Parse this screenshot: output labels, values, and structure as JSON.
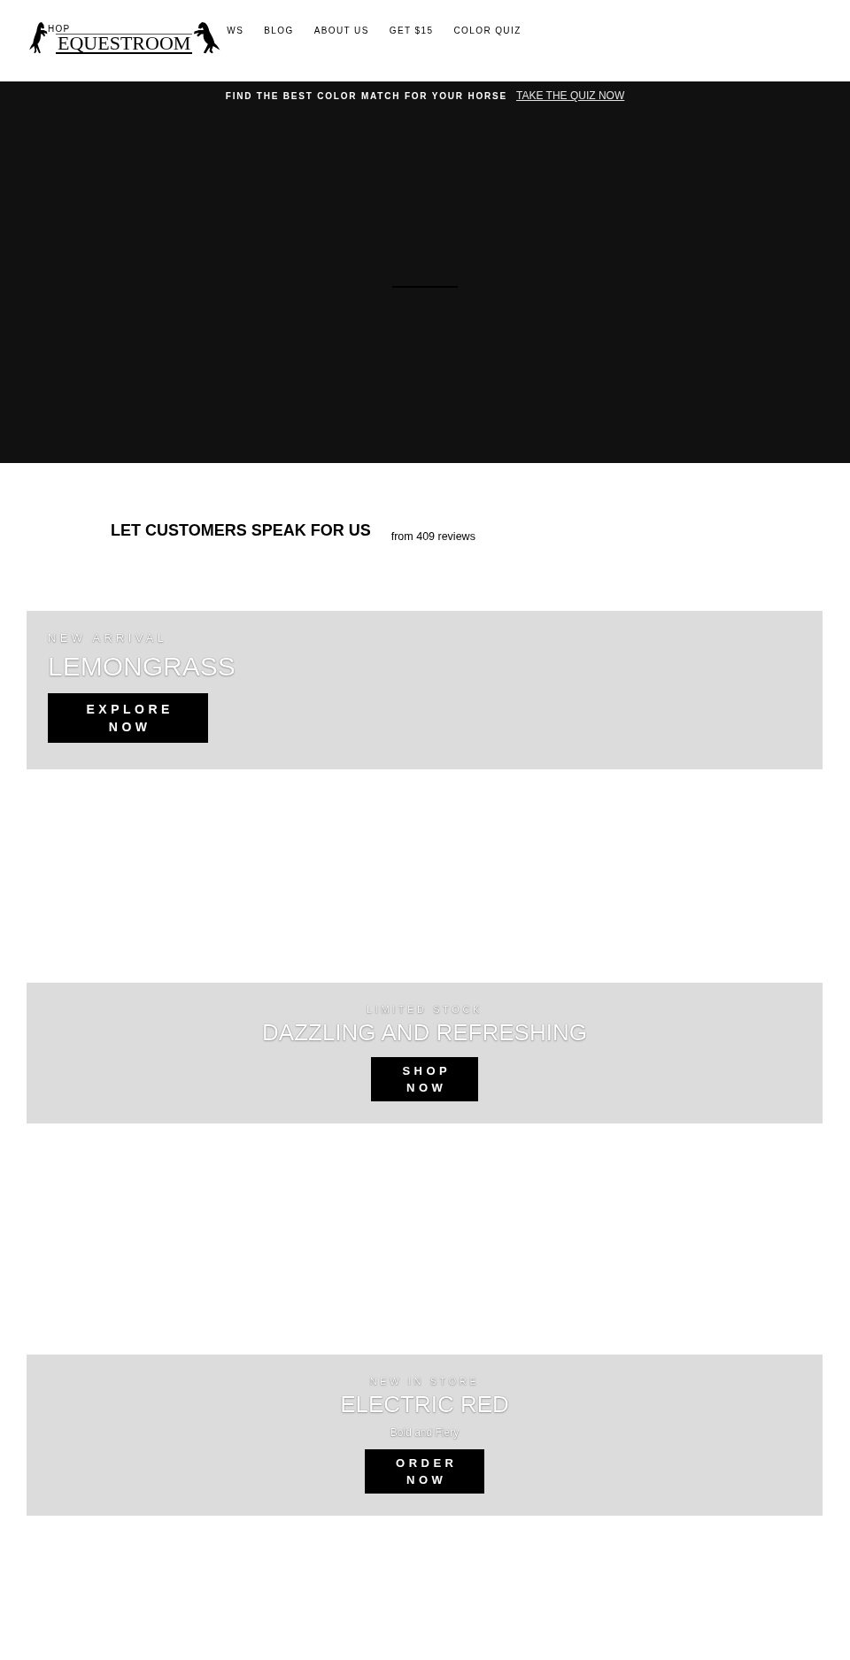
{
  "header": {
    "logo": {
      "wordmark": "EQUESTROOM"
    },
    "nav_under_logo": [
      "HOP"
    ],
    "nav": [
      "WS",
      "BLOG",
      "ABOUT US",
      "GET $15",
      "COLOR QUIZ"
    ]
  },
  "announcement": {
    "text": "FIND THE BEST COLOR MATCH FOR YOUR HORSE",
    "link": "TAKE THE QUIZ NOW"
  },
  "reviews": {
    "heading": "LET CUSTOMERS SPEAK FOR US",
    "count": "from 409 reviews"
  },
  "promos": [
    {
      "kind": "left",
      "eyebrow": "NEW ARRIVAL",
      "title": "LEMONGRASS",
      "button": "EXPLORE NOW"
    },
    {
      "kind": "centered",
      "eyebrow": "LIMITED STOCK",
      "title": "DAZZLING AND REFRESHING",
      "button": "SHOP NOW"
    },
    {
      "kind": "centered",
      "eyebrow": "NEW IN STORE",
      "title": "ELECTRIC RED",
      "subtitle": "Bold and Fiery",
      "button": "ORDER NOW"
    }
  ]
}
